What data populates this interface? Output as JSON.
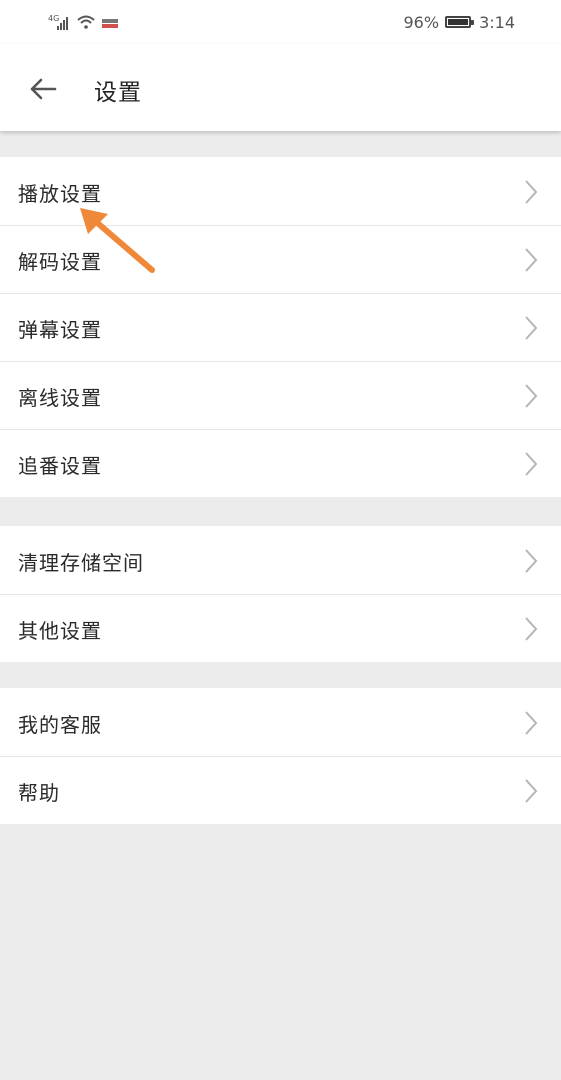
{
  "status_bar": {
    "network": "4G",
    "battery_percent": "96%",
    "time": "3:14"
  },
  "header": {
    "title": "设置"
  },
  "groups": [
    {
      "items": [
        {
          "label": "播放设置"
        },
        {
          "label": "解码设置"
        },
        {
          "label": "弹幕设置"
        },
        {
          "label": "离线设置"
        },
        {
          "label": "追番设置"
        }
      ]
    },
    {
      "items": [
        {
          "label": "清理存储空间"
        },
        {
          "label": "其他设置"
        }
      ]
    },
    {
      "items": [
        {
          "label": "我的客服"
        },
        {
          "label": "帮助"
        }
      ]
    }
  ],
  "colors": {
    "annotation_arrow": "#f0883a",
    "background": "#ececec",
    "chevron": "#b5b5b5"
  }
}
